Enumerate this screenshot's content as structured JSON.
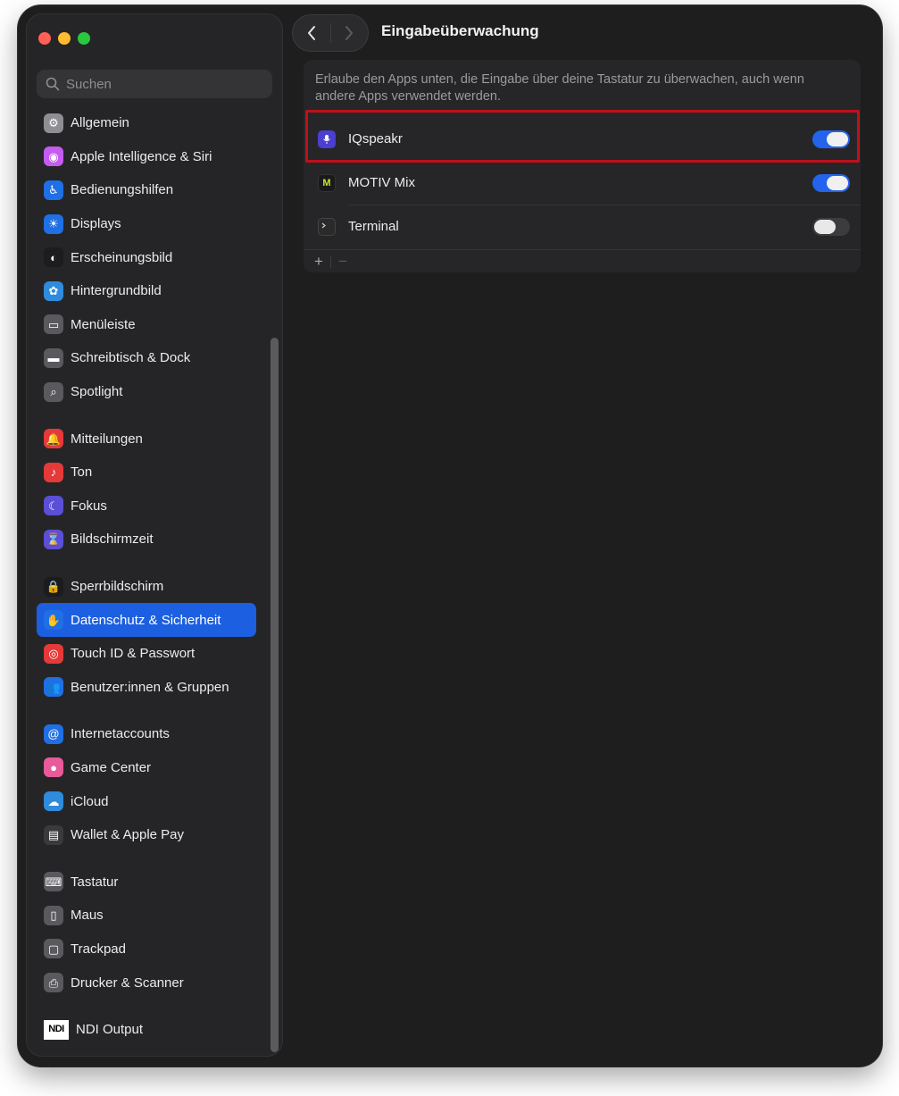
{
  "window": {
    "title": "Eingabeüberwachung"
  },
  "search": {
    "placeholder": "Suchen"
  },
  "sidebar": {
    "groups": [
      [
        {
          "label": "Allgemein",
          "icon": "gear-icon",
          "color": "#8e8e93"
        },
        {
          "label": "Apple Intelligence & Siri",
          "icon": "siri-icon",
          "color": "#c45cf0"
        },
        {
          "label": "Bedienungshilfen",
          "icon": "accessibility-icon",
          "color": "#1f6fe5"
        },
        {
          "label": "Displays",
          "icon": "sun-icon",
          "color": "#1f6fe5"
        },
        {
          "label": "Erscheinungsbild",
          "icon": "appearance-icon",
          "color": "#1c1c1e"
        },
        {
          "label": "Hintergrundbild",
          "icon": "flower-icon",
          "color": "#2f8bdb"
        },
        {
          "label": "Menüleiste",
          "icon": "menubar-icon",
          "color": "#5a5a5e"
        },
        {
          "label": "Schreibtisch & Dock",
          "icon": "dock-icon",
          "color": "#5a5a5e"
        },
        {
          "label": "Spotlight",
          "icon": "magnifier-icon",
          "color": "#5a5a5e"
        }
      ],
      [
        {
          "label": "Mitteilungen",
          "icon": "bell-icon",
          "color": "#e5393a"
        },
        {
          "label": "Ton",
          "icon": "speaker-icon",
          "color": "#e5393a"
        },
        {
          "label": "Fokus",
          "icon": "moon-icon",
          "color": "#5b4fd6"
        },
        {
          "label": "Bildschirmzeit",
          "icon": "hourglass-icon",
          "color": "#5b4fd6"
        }
      ],
      [
        {
          "label": "Sperrbildschirm",
          "icon": "lock-icon",
          "color": "#1c1c1e"
        },
        {
          "label": "Datenschutz & Sicherheit",
          "icon": "hand-icon",
          "color": "#1f6fe5",
          "active": true
        },
        {
          "label": "Touch ID & Passwort",
          "icon": "fingerprint-icon",
          "color": "#e5393a"
        },
        {
          "label": "Benutzer:innen & Gruppen",
          "icon": "users-icon",
          "color": "#1f6fe5"
        }
      ],
      [
        {
          "label": "Internetaccounts",
          "icon": "at-icon",
          "color": "#1f6fe5"
        },
        {
          "label": "Game Center",
          "icon": "gamecenter-icon",
          "color": "#e85a9a"
        },
        {
          "label": "iCloud",
          "icon": "cloud-icon",
          "color": "#2f8bdb"
        },
        {
          "label": "Wallet & Apple Pay",
          "icon": "wallet-icon",
          "color": "#3a3a3c"
        }
      ],
      [
        {
          "label": "Tastatur",
          "icon": "keyboard-icon",
          "color": "#5a5a5e"
        },
        {
          "label": "Maus",
          "icon": "mouse-icon",
          "color": "#5a5a5e"
        },
        {
          "label": "Trackpad",
          "icon": "trackpad-icon",
          "color": "#5a5a5e"
        },
        {
          "label": "Drucker & Scanner",
          "icon": "printer-icon",
          "color": "#5a5a5e"
        }
      ],
      [
        {
          "label": "NDI Output",
          "icon": "ndi-icon",
          "badge": "NDI",
          "color": "#ffffff"
        }
      ]
    ]
  },
  "content": {
    "description": "Erlaube den Apps unten, die Eingabe über deine Tastatur zu überwachen, auch wenn andere Apps verwendet werden.",
    "apps": [
      {
        "name": "IQspeakr",
        "icon": "microphone-icon",
        "enabled": true,
        "highlighted": true
      },
      {
        "name": "MOTIV Mix",
        "icon": "motiv-icon",
        "badge": "M",
        "enabled": true
      },
      {
        "name": "Terminal",
        "icon": "terminal-icon",
        "enabled": false
      }
    ],
    "add_button": "+",
    "remove_button": "−"
  },
  "colors": {
    "accent": "#1c5fe0",
    "toggle_on": "#2463eb",
    "highlight": "#c0101c",
    "close": "#fe5f57",
    "minimize": "#febc2e",
    "zoom": "#28c840"
  }
}
